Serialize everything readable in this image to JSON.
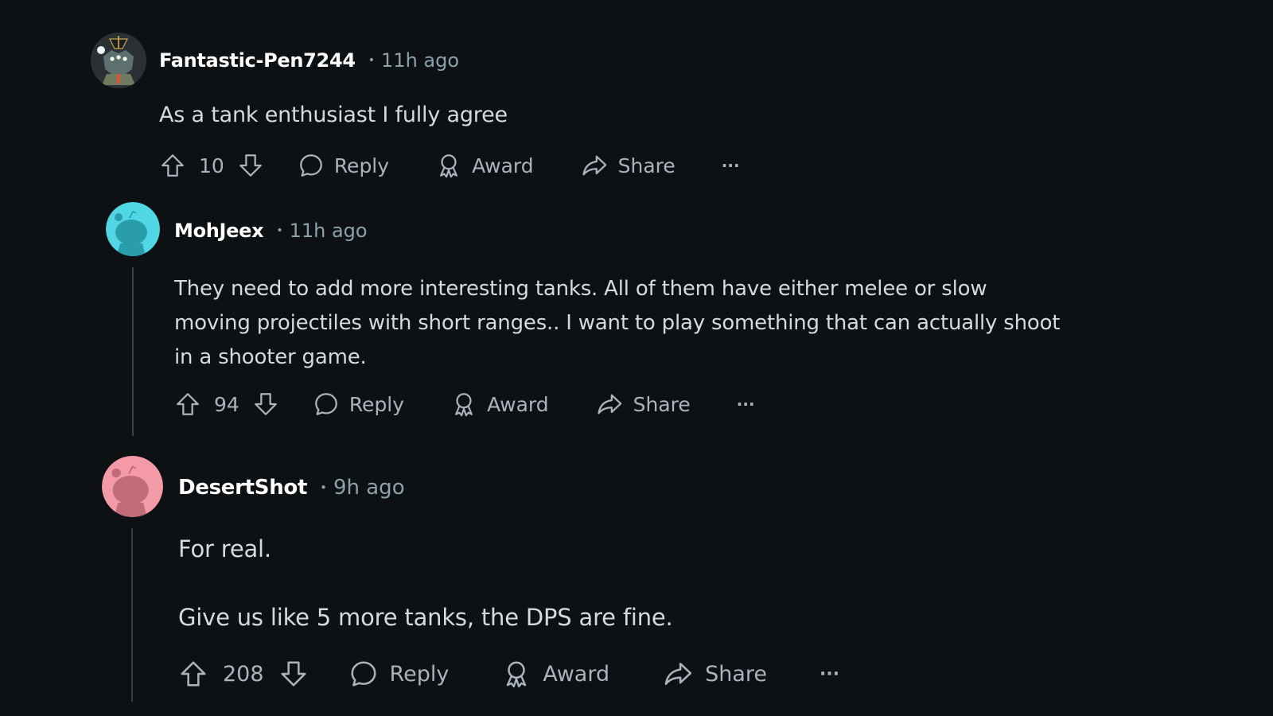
{
  "comments": [
    {
      "username": "Fantastic-Pen7244",
      "separator": "•",
      "time": "11h ago",
      "avatar": "custom-character-avatar",
      "body": [
        "As a tank enthusiast I fully agree"
      ],
      "votes": "10",
      "actions": {
        "reply": "Reply",
        "award": "Award",
        "share": "Share",
        "more": "···"
      }
    },
    {
      "username": "MohJeex",
      "separator": "•",
      "time": "11h ago",
      "avatar": "default-snoo-avatar",
      "avatar_color": "#4fd7e6",
      "body": [
        "They need to add more interesting tanks. All of them have either melee or slow",
        "moving projectiles with short ranges.. I want to play something that can actually shoot",
        "in a shooter game."
      ],
      "votes": "94",
      "actions": {
        "reply": "Reply",
        "award": "Award",
        "share": "Share",
        "more": "···"
      }
    },
    {
      "username": "DesertShot",
      "separator": "•",
      "time": "9h ago",
      "avatar": "default-snoo-avatar",
      "avatar_color": "#f49aa6",
      "body": [
        "For real.",
        "Give us like 5 more tanks, the DPS are fine."
      ],
      "votes": "208",
      "actions": {
        "reply": "Reply",
        "award": "Award",
        "share": "Share",
        "more": "···"
      }
    }
  ],
  "colors": {
    "background": "#0e1113",
    "text": "#d7dadc",
    "meta": "#8ba2ad",
    "icon": "#a9b4bb",
    "thread_line": "#3a3f44"
  }
}
